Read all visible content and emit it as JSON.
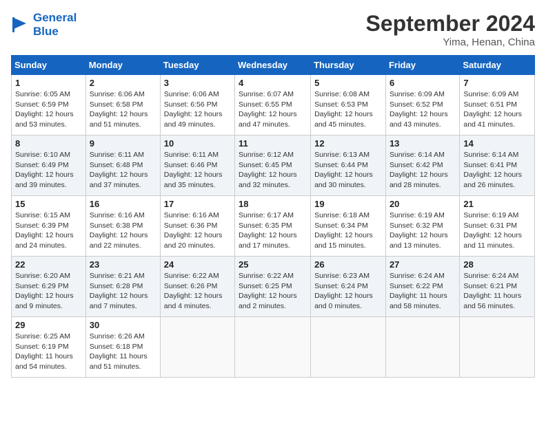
{
  "header": {
    "logo_line1": "General",
    "logo_line2": "Blue",
    "month": "September 2024",
    "location": "Yima, Henan, China"
  },
  "weekdays": [
    "Sunday",
    "Monday",
    "Tuesday",
    "Wednesday",
    "Thursday",
    "Friday",
    "Saturday"
  ],
  "weeks": [
    [
      {
        "day": "1",
        "info": "Sunrise: 6:05 AM\nSunset: 6:59 PM\nDaylight: 12 hours\nand 53 minutes."
      },
      {
        "day": "2",
        "info": "Sunrise: 6:06 AM\nSunset: 6:58 PM\nDaylight: 12 hours\nand 51 minutes."
      },
      {
        "day": "3",
        "info": "Sunrise: 6:06 AM\nSunset: 6:56 PM\nDaylight: 12 hours\nand 49 minutes."
      },
      {
        "day": "4",
        "info": "Sunrise: 6:07 AM\nSunset: 6:55 PM\nDaylight: 12 hours\nand 47 minutes."
      },
      {
        "day": "5",
        "info": "Sunrise: 6:08 AM\nSunset: 6:53 PM\nDaylight: 12 hours\nand 45 minutes."
      },
      {
        "day": "6",
        "info": "Sunrise: 6:09 AM\nSunset: 6:52 PM\nDaylight: 12 hours\nand 43 minutes."
      },
      {
        "day": "7",
        "info": "Sunrise: 6:09 AM\nSunset: 6:51 PM\nDaylight: 12 hours\nand 41 minutes."
      }
    ],
    [
      {
        "day": "8",
        "info": "Sunrise: 6:10 AM\nSunset: 6:49 PM\nDaylight: 12 hours\nand 39 minutes."
      },
      {
        "day": "9",
        "info": "Sunrise: 6:11 AM\nSunset: 6:48 PM\nDaylight: 12 hours\nand 37 minutes."
      },
      {
        "day": "10",
        "info": "Sunrise: 6:11 AM\nSunset: 6:46 PM\nDaylight: 12 hours\nand 35 minutes."
      },
      {
        "day": "11",
        "info": "Sunrise: 6:12 AM\nSunset: 6:45 PM\nDaylight: 12 hours\nand 32 minutes."
      },
      {
        "day": "12",
        "info": "Sunrise: 6:13 AM\nSunset: 6:44 PM\nDaylight: 12 hours\nand 30 minutes."
      },
      {
        "day": "13",
        "info": "Sunrise: 6:14 AM\nSunset: 6:42 PM\nDaylight: 12 hours\nand 28 minutes."
      },
      {
        "day": "14",
        "info": "Sunrise: 6:14 AM\nSunset: 6:41 PM\nDaylight: 12 hours\nand 26 minutes."
      }
    ],
    [
      {
        "day": "15",
        "info": "Sunrise: 6:15 AM\nSunset: 6:39 PM\nDaylight: 12 hours\nand 24 minutes."
      },
      {
        "day": "16",
        "info": "Sunrise: 6:16 AM\nSunset: 6:38 PM\nDaylight: 12 hours\nand 22 minutes."
      },
      {
        "day": "17",
        "info": "Sunrise: 6:16 AM\nSunset: 6:36 PM\nDaylight: 12 hours\nand 20 minutes."
      },
      {
        "day": "18",
        "info": "Sunrise: 6:17 AM\nSunset: 6:35 PM\nDaylight: 12 hours\nand 17 minutes."
      },
      {
        "day": "19",
        "info": "Sunrise: 6:18 AM\nSunset: 6:34 PM\nDaylight: 12 hours\nand 15 minutes."
      },
      {
        "day": "20",
        "info": "Sunrise: 6:19 AM\nSunset: 6:32 PM\nDaylight: 12 hours\nand 13 minutes."
      },
      {
        "day": "21",
        "info": "Sunrise: 6:19 AM\nSunset: 6:31 PM\nDaylight: 12 hours\nand 11 minutes."
      }
    ],
    [
      {
        "day": "22",
        "info": "Sunrise: 6:20 AM\nSunset: 6:29 PM\nDaylight: 12 hours\nand 9 minutes."
      },
      {
        "day": "23",
        "info": "Sunrise: 6:21 AM\nSunset: 6:28 PM\nDaylight: 12 hours\nand 7 minutes."
      },
      {
        "day": "24",
        "info": "Sunrise: 6:22 AM\nSunset: 6:26 PM\nDaylight: 12 hours\nand 4 minutes."
      },
      {
        "day": "25",
        "info": "Sunrise: 6:22 AM\nSunset: 6:25 PM\nDaylight: 12 hours\nand 2 minutes."
      },
      {
        "day": "26",
        "info": "Sunrise: 6:23 AM\nSunset: 6:24 PM\nDaylight: 12 hours\nand 0 minutes."
      },
      {
        "day": "27",
        "info": "Sunrise: 6:24 AM\nSunset: 6:22 PM\nDaylight: 11 hours\nand 58 minutes."
      },
      {
        "day": "28",
        "info": "Sunrise: 6:24 AM\nSunset: 6:21 PM\nDaylight: 11 hours\nand 56 minutes."
      }
    ],
    [
      {
        "day": "29",
        "info": "Sunrise: 6:25 AM\nSunset: 6:19 PM\nDaylight: 11 hours\nand 54 minutes."
      },
      {
        "day": "30",
        "info": "Sunrise: 6:26 AM\nSunset: 6:18 PM\nDaylight: 11 hours\nand 51 minutes."
      },
      {
        "day": "",
        "info": ""
      },
      {
        "day": "",
        "info": ""
      },
      {
        "day": "",
        "info": ""
      },
      {
        "day": "",
        "info": ""
      },
      {
        "day": "",
        "info": ""
      }
    ]
  ]
}
